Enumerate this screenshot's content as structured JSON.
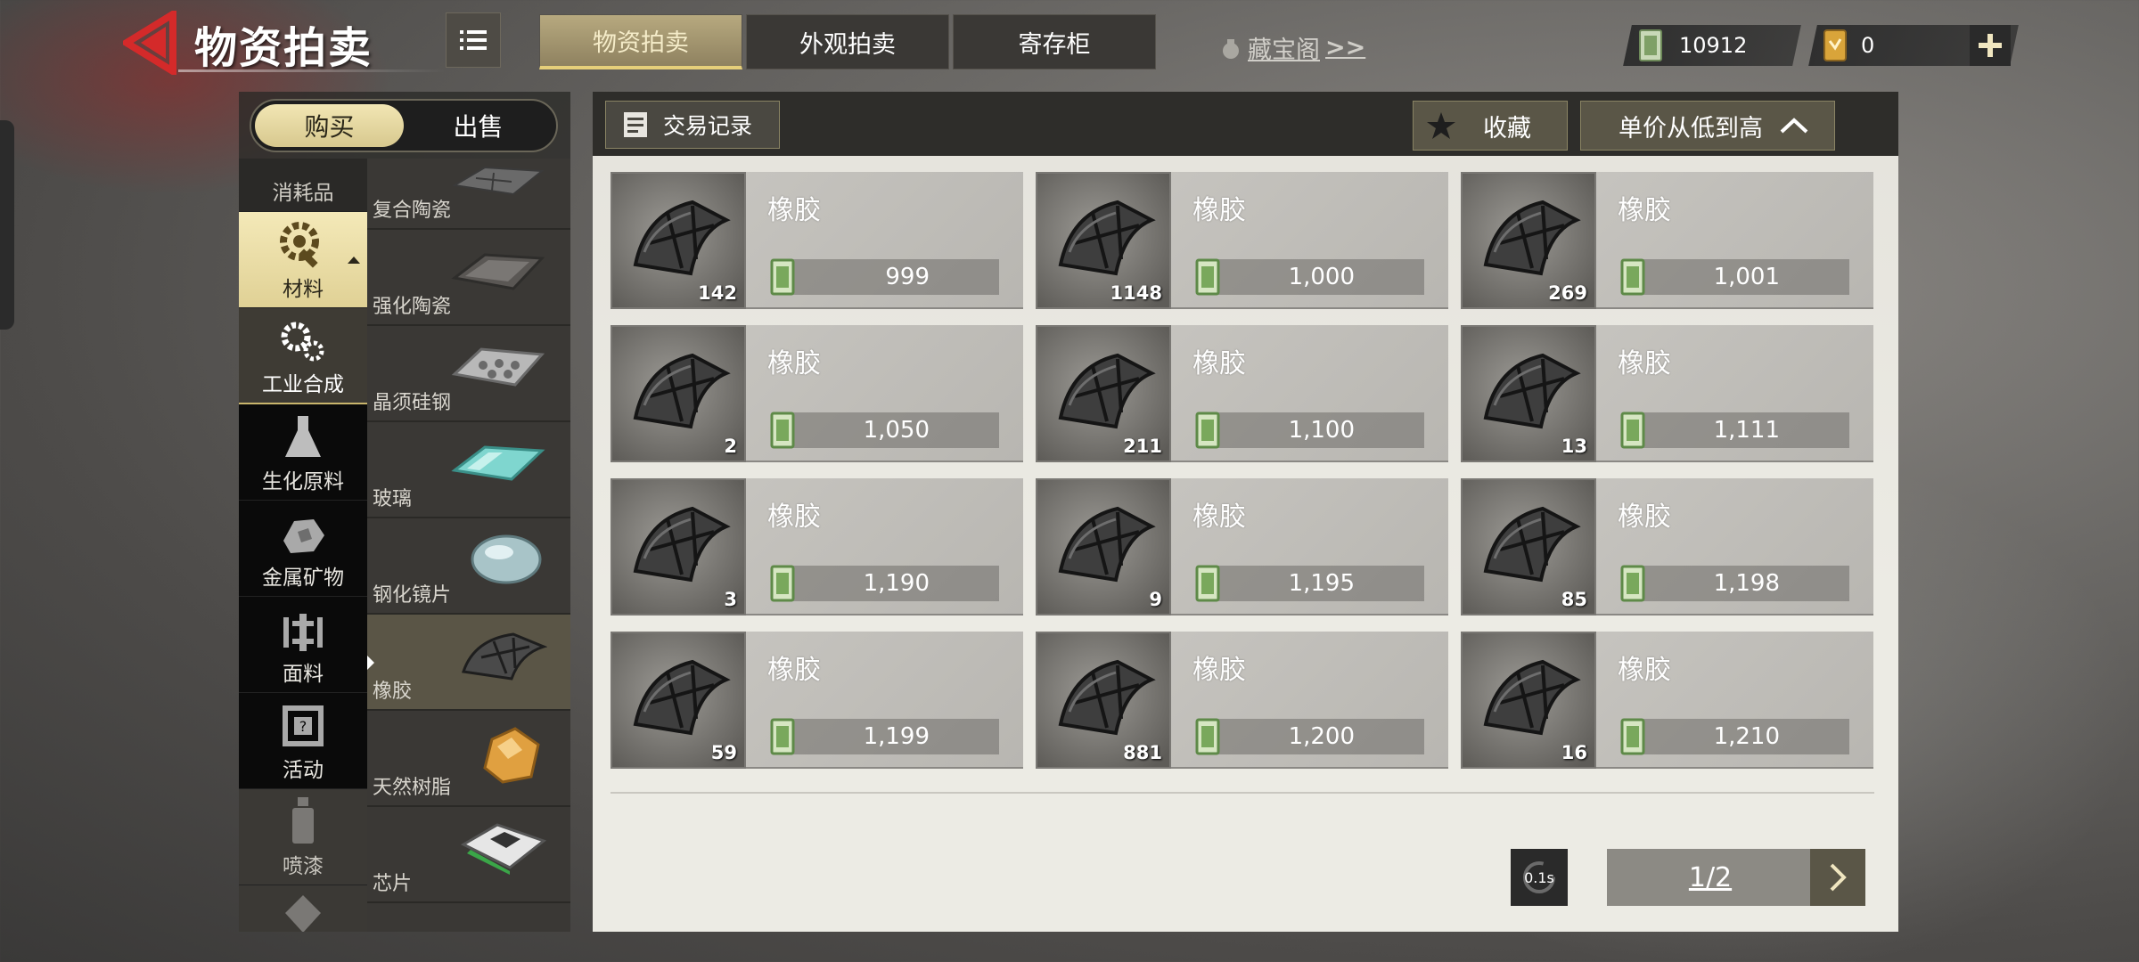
{
  "header": {
    "title": "物资拍卖",
    "tabs": [
      {
        "label": "物资拍卖",
        "active": true
      },
      {
        "label": "外观拍卖",
        "active": false
      },
      {
        "label": "寄存柜",
        "active": false
      }
    ],
    "treasure_link": "藏宝阁",
    "treasure_arrows": ">>",
    "currency_cash": "10912",
    "currency_ticket": "0"
  },
  "side": {
    "buy_label": "购买",
    "sell_label": "出售",
    "categories": [
      {
        "label": "消耗品",
        "icon": "consumable-icon"
      },
      {
        "label": "材料",
        "icon": "wrench-gear-icon",
        "active": true
      },
      {
        "label": "工业合成",
        "icon": "gears-icon",
        "selected": true
      },
      {
        "label": "生化原料",
        "icon": "flask-icon"
      },
      {
        "label": "金属矿物",
        "icon": "ore-icon"
      },
      {
        "label": "面料",
        "icon": "fabric-icon"
      },
      {
        "label": "活动",
        "icon": "event-chip-icon"
      },
      {
        "label": "喷漆",
        "icon": "spray-can-icon"
      }
    ],
    "items": [
      {
        "label": "复合陶瓷",
        "icon": "ceramic-plate-icon"
      },
      {
        "label": "强化陶瓷",
        "icon": "reinforced-ceramic-icon"
      },
      {
        "label": "晶须硅钢",
        "icon": "silicon-steel-icon"
      },
      {
        "label": "玻璃",
        "icon": "glass-icon"
      },
      {
        "label": "钢化镜片",
        "icon": "lens-icon"
      },
      {
        "label": "橡胶",
        "icon": "rubber-icon",
        "active": true
      },
      {
        "label": "天然树脂",
        "icon": "resin-icon"
      },
      {
        "label": "芯片",
        "icon": "chip-icon"
      }
    ]
  },
  "toolbar": {
    "trade_record": "交易记录",
    "favorite": "收藏",
    "sort": "单价从低到高"
  },
  "listings": [
    {
      "name": "橡胶",
      "qty": "142",
      "price": "999"
    },
    {
      "name": "橡胶",
      "qty": "1148",
      "price": "1,000"
    },
    {
      "name": "橡胶",
      "qty": "269",
      "price": "1,001"
    },
    {
      "name": "橡胶",
      "qty": "2",
      "price": "1,050"
    },
    {
      "name": "橡胶",
      "qty": "211",
      "price": "1,100"
    },
    {
      "name": "橡胶",
      "qty": "13",
      "price": "1,111"
    },
    {
      "name": "橡胶",
      "qty": "3",
      "price": "1,190"
    },
    {
      "name": "橡胶",
      "qty": "9",
      "price": "1,195"
    },
    {
      "name": "橡胶",
      "qty": "85",
      "price": "1,198"
    },
    {
      "name": "橡胶",
      "qty": "59",
      "price": "1,199"
    },
    {
      "name": "橡胶",
      "qty": "881",
      "price": "1,200"
    },
    {
      "name": "橡胶",
      "qty": "16",
      "price": "1,210"
    }
  ],
  "footer": {
    "refresh_label": "0.1s",
    "page": "1/2"
  },
  "colors": {
    "accent_gold": "#e6cf7a",
    "active_tab": "#b7a97f",
    "back_red": "#d42a2a"
  }
}
